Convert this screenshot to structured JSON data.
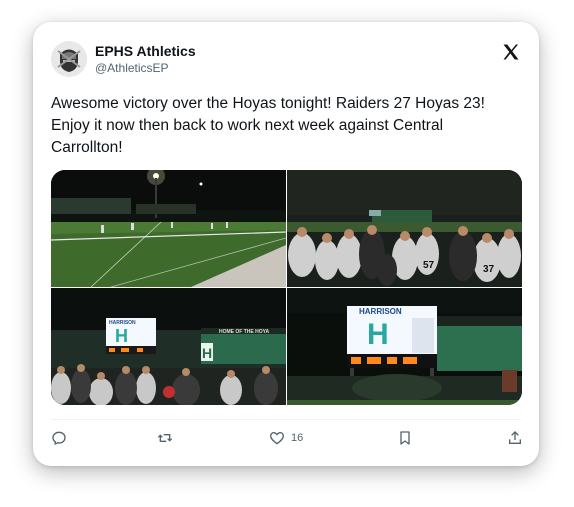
{
  "post": {
    "author_name": "EPHS Athletics",
    "author_handle": "@AthleticsEP",
    "text": "Awesome victory over the Hoyas tonight! Raiders 27 Hoyas 23! Enjoy it now then back to work next week against Central Carrollton!",
    "like_count": "16"
  },
  "photos": {
    "scoreboard_left_title": "HARRISON",
    "scoreboard_left_letter": "H",
    "scoreboard_left_sign": "HOME OF THE HOYA",
    "scoreboard_right_title": "HARRISON",
    "scoreboard_right_letter": "H",
    "jersey_1": "57",
    "jersey_2": "37"
  },
  "icons": {
    "platform": "x-logo-icon",
    "reply": "reply-icon",
    "repost": "repost-icon",
    "like": "heart-icon",
    "bookmark": "bookmark-icon",
    "share": "share-icon"
  },
  "colors": {
    "text": "#0f1419",
    "secondary": "#536471",
    "scoreboard_teal": "#2aa7a0"
  }
}
